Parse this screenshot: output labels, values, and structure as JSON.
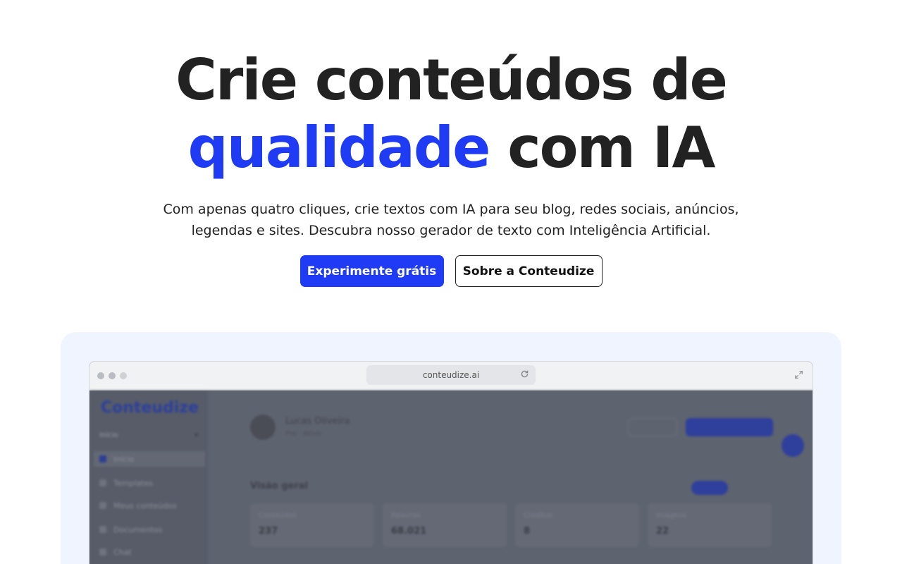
{
  "hero": {
    "title_line1": "Crie conteúdos de",
    "title_accent": "qualidade",
    "title_rest": " com IA",
    "subtitle": "Com apenas quatro cliques, crie textos com IA para seu blog, redes sociais, anúncios, legendas e sites. Descubra nosso gerador de texto com Inteligência Artificial.",
    "cta_primary": "Experimente grátis",
    "cta_secondary": "Sobre a Conteudize"
  },
  "browser": {
    "url": "conteudize.ai",
    "reload_icon": "reload-icon",
    "expand_icon": "expand-icon"
  },
  "app_preview": {
    "logo": "Conteudize",
    "sidebar": {
      "select_label": "Início",
      "items": [
        "Início",
        "Templates",
        "Meus conteúdos",
        "Documentos",
        "Chat"
      ]
    },
    "user": {
      "name": "Lucas Oliveira",
      "subtitle": "Pro · Ativo"
    },
    "overview_title": "Visão geral",
    "cards": [
      {
        "label": "Conteúdos",
        "value": "237"
      },
      {
        "label": "Palavras",
        "value": "68.021"
      },
      {
        "label": "Créditos",
        "value": "8"
      },
      {
        "label": "Imagens",
        "value": "22"
      }
    ]
  },
  "colors": {
    "accent": "#1f3bf3",
    "text": "#222222",
    "showcase_bg": "#eff4fe"
  }
}
